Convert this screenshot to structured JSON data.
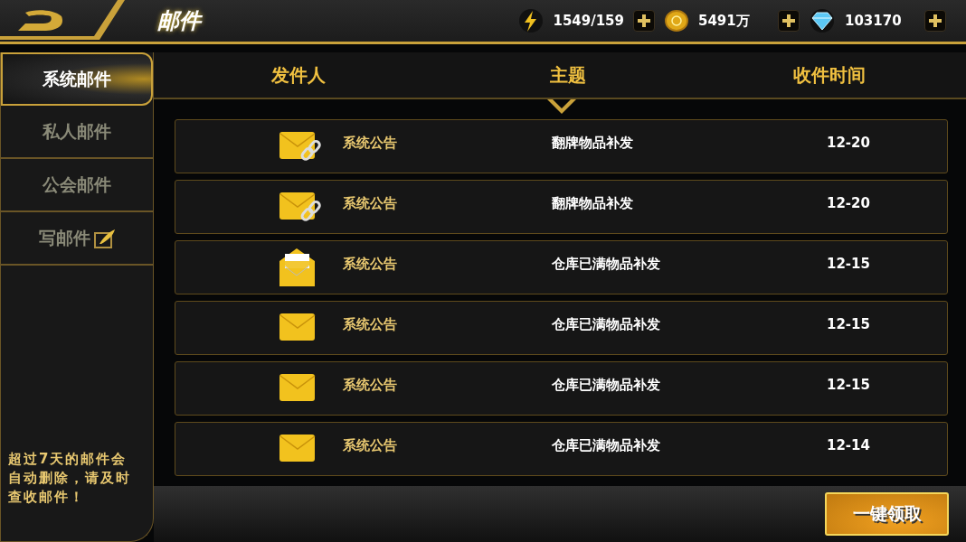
{
  "header": {
    "title": "邮件",
    "resources": [
      {
        "kind": "energy",
        "value": "1549/159"
      },
      {
        "kind": "coin",
        "value": "5491万"
      },
      {
        "kind": "diamond",
        "value": "103170"
      }
    ]
  },
  "sidebar": {
    "tabs": [
      {
        "label": "系统邮件",
        "selected": true
      },
      {
        "label": "私人邮件",
        "selected": false
      },
      {
        "label": "公会邮件",
        "selected": false
      },
      {
        "label": "写邮件",
        "selected": false,
        "kind": "compose"
      }
    ],
    "notice": "超过7天的邮件会自动删除，请及时查收邮件！"
  },
  "table": {
    "columns": [
      "发件人",
      "主题",
      "收件时间"
    ],
    "rows": [
      {
        "kind": "attachment",
        "sender": "系统公告",
        "subject": "翻牌物品补发",
        "time": "12-20"
      },
      {
        "kind": "attachment",
        "sender": "系统公告",
        "subject": "翻牌物品补发",
        "time": "12-20"
      },
      {
        "kind": "opened",
        "sender": "系统公告",
        "subject": "仓库已满物品补发",
        "time": "12-15"
      },
      {
        "kind": "unread",
        "sender": "系统公告",
        "subject": "仓库已满物品补发",
        "time": "12-15"
      },
      {
        "kind": "unread",
        "sender": "系统公告",
        "subject": "仓库已满物品补发",
        "time": "12-15"
      },
      {
        "kind": "unread",
        "sender": "系统公告",
        "subject": "仓库已满物品补发",
        "time": "12-14"
      }
    ]
  },
  "footer": {
    "button": "一键领取"
  }
}
